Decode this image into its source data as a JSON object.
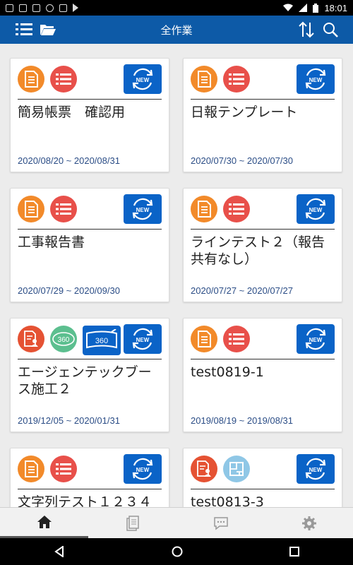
{
  "status_bar": {
    "time": "18:01"
  },
  "app_bar": {
    "title": "全作業"
  },
  "cards": [
    {
      "title": "簡易帳票　確認用",
      "date": "2020/08/20 ~ 2020/08/31",
      "icons": [
        "document-icon",
        "list-icon"
      ]
    },
    {
      "title": "日報テンプレート",
      "date": "2020/07/30 ~ 2020/07/30",
      "icons": [
        "document-icon",
        "list-icon"
      ]
    },
    {
      "title": "工事報告書",
      "date": "2020/07/29 ~ 2020/09/30",
      "icons": [
        "document-icon",
        "list-icon"
      ]
    },
    {
      "title": "ラインテスト２（報告共有なし）",
      "date": "2020/07/27 ~ 2020/07/27",
      "icons": [
        "document-icon",
        "list-icon"
      ]
    },
    {
      "title": "エージェンテックブース施工２",
      "date": "2019/12/05 ~ 2020/01/31",
      "icons": [
        "document-person-icon",
        "360-icon",
        "360-panorama-icon"
      ]
    },
    {
      "title": "test0819-1",
      "date": "2019/08/19 ~ 2019/08/31",
      "icons": [
        "document-icon",
        "list-icon"
      ]
    },
    {
      "title": "文字列テスト１２３４",
      "date": "",
      "icons": [
        "document-icon",
        "list-icon"
      ]
    },
    {
      "title": "test0813-3",
      "date": "",
      "icons": [
        "document-person-icon",
        "blueprint-icon"
      ]
    }
  ],
  "new_badge": "NEW",
  "badge_360": "360",
  "colors": {
    "app_bar": "#0d5aa7",
    "orange": "#f28a2a",
    "red": "#e8504a",
    "new_button": "#0a63c7",
    "date": "#2b4d86"
  }
}
